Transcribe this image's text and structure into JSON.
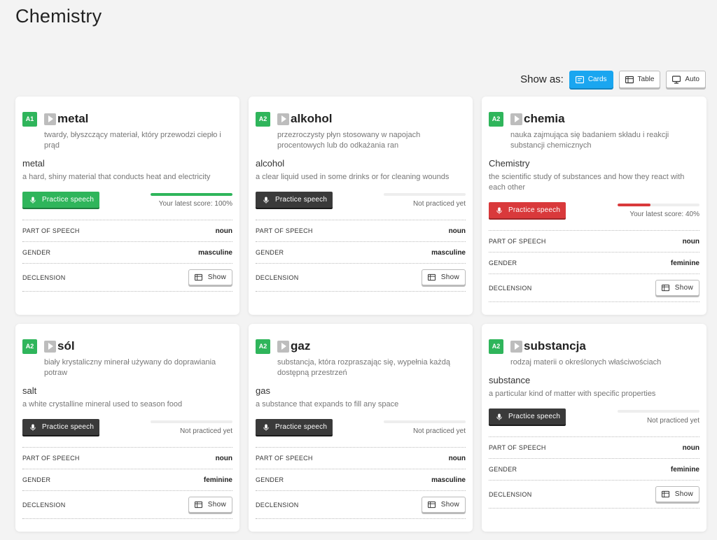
{
  "page": {
    "title": "Chemistry"
  },
  "view": {
    "label": "Show as:",
    "options": [
      "Cards",
      "Table",
      "Auto"
    ],
    "selected": "Cards"
  },
  "labels": {
    "part_of_speech": "PART OF SPEECH",
    "gender": "GENDER",
    "declension": "DECLENSION",
    "show": "Show",
    "practice": "Practice speech"
  },
  "colors": {
    "green": "#2fb55b",
    "red": "#d9393b",
    "accent_blue": "#1aa6f0"
  },
  "cards": [
    {
      "level": "A1",
      "word": "metal",
      "definition_pl": "twardy, błyszczący materiał, który przewodzi ciepło i prąd",
      "translation": "metal",
      "definition_en": "a hard, shiny material that conducts heat and electricity",
      "practice_state": "green",
      "score_fraction": 1.0,
      "score_text": "Your latest score: 100%",
      "part_of_speech": "noun",
      "gender": "masculine"
    },
    {
      "level": "A2",
      "word": "alkohol",
      "definition_pl": "przezroczysty płyn stosowany w napojach procentowych lub do odkażania ran",
      "translation": "alcohol",
      "definition_en": "a clear liquid used in some drinks or for cleaning wounds",
      "practice_state": "dark",
      "score_fraction": 0,
      "score_text": "Not practiced yet",
      "part_of_speech": "noun",
      "gender": "masculine"
    },
    {
      "level": "A2",
      "word": "chemia",
      "definition_pl": "nauka zajmująca się badaniem składu i reakcji substancji chemicznych",
      "translation": "Chemistry",
      "definition_en": "the scientific study of substances and how they react with each other",
      "practice_state": "red",
      "score_fraction": 0.4,
      "score_text": "Your latest score: 40%",
      "part_of_speech": "noun",
      "gender": "feminine"
    },
    {
      "level": "A2",
      "word": "sól",
      "definition_pl": "biały krystaliczny minerał używany do doprawiania potraw",
      "translation": "salt",
      "definition_en": "a white crystalline mineral used to season food",
      "practice_state": "dark",
      "score_fraction": 0,
      "score_text": "Not practiced yet",
      "part_of_speech": "noun",
      "gender": "feminine"
    },
    {
      "level": "A2",
      "word": "gaz",
      "definition_pl": "substancja, która rozpraszając się, wypełnia każdą dostępną przestrzeń",
      "translation": "gas",
      "definition_en": "a substance that expands to fill any space",
      "practice_state": "dark",
      "score_fraction": 0,
      "score_text": "Not practiced yet",
      "part_of_speech": "noun",
      "gender": "masculine"
    },
    {
      "level": "A2",
      "word": "substancja",
      "definition_pl": "rodzaj materii o określonych właściwościach",
      "translation": "substance",
      "definition_en": "a particular kind of matter with specific properties",
      "practice_state": "dark",
      "score_fraction": 0,
      "score_text": "Not practiced yet",
      "part_of_speech": "noun",
      "gender": "feminine"
    }
  ]
}
